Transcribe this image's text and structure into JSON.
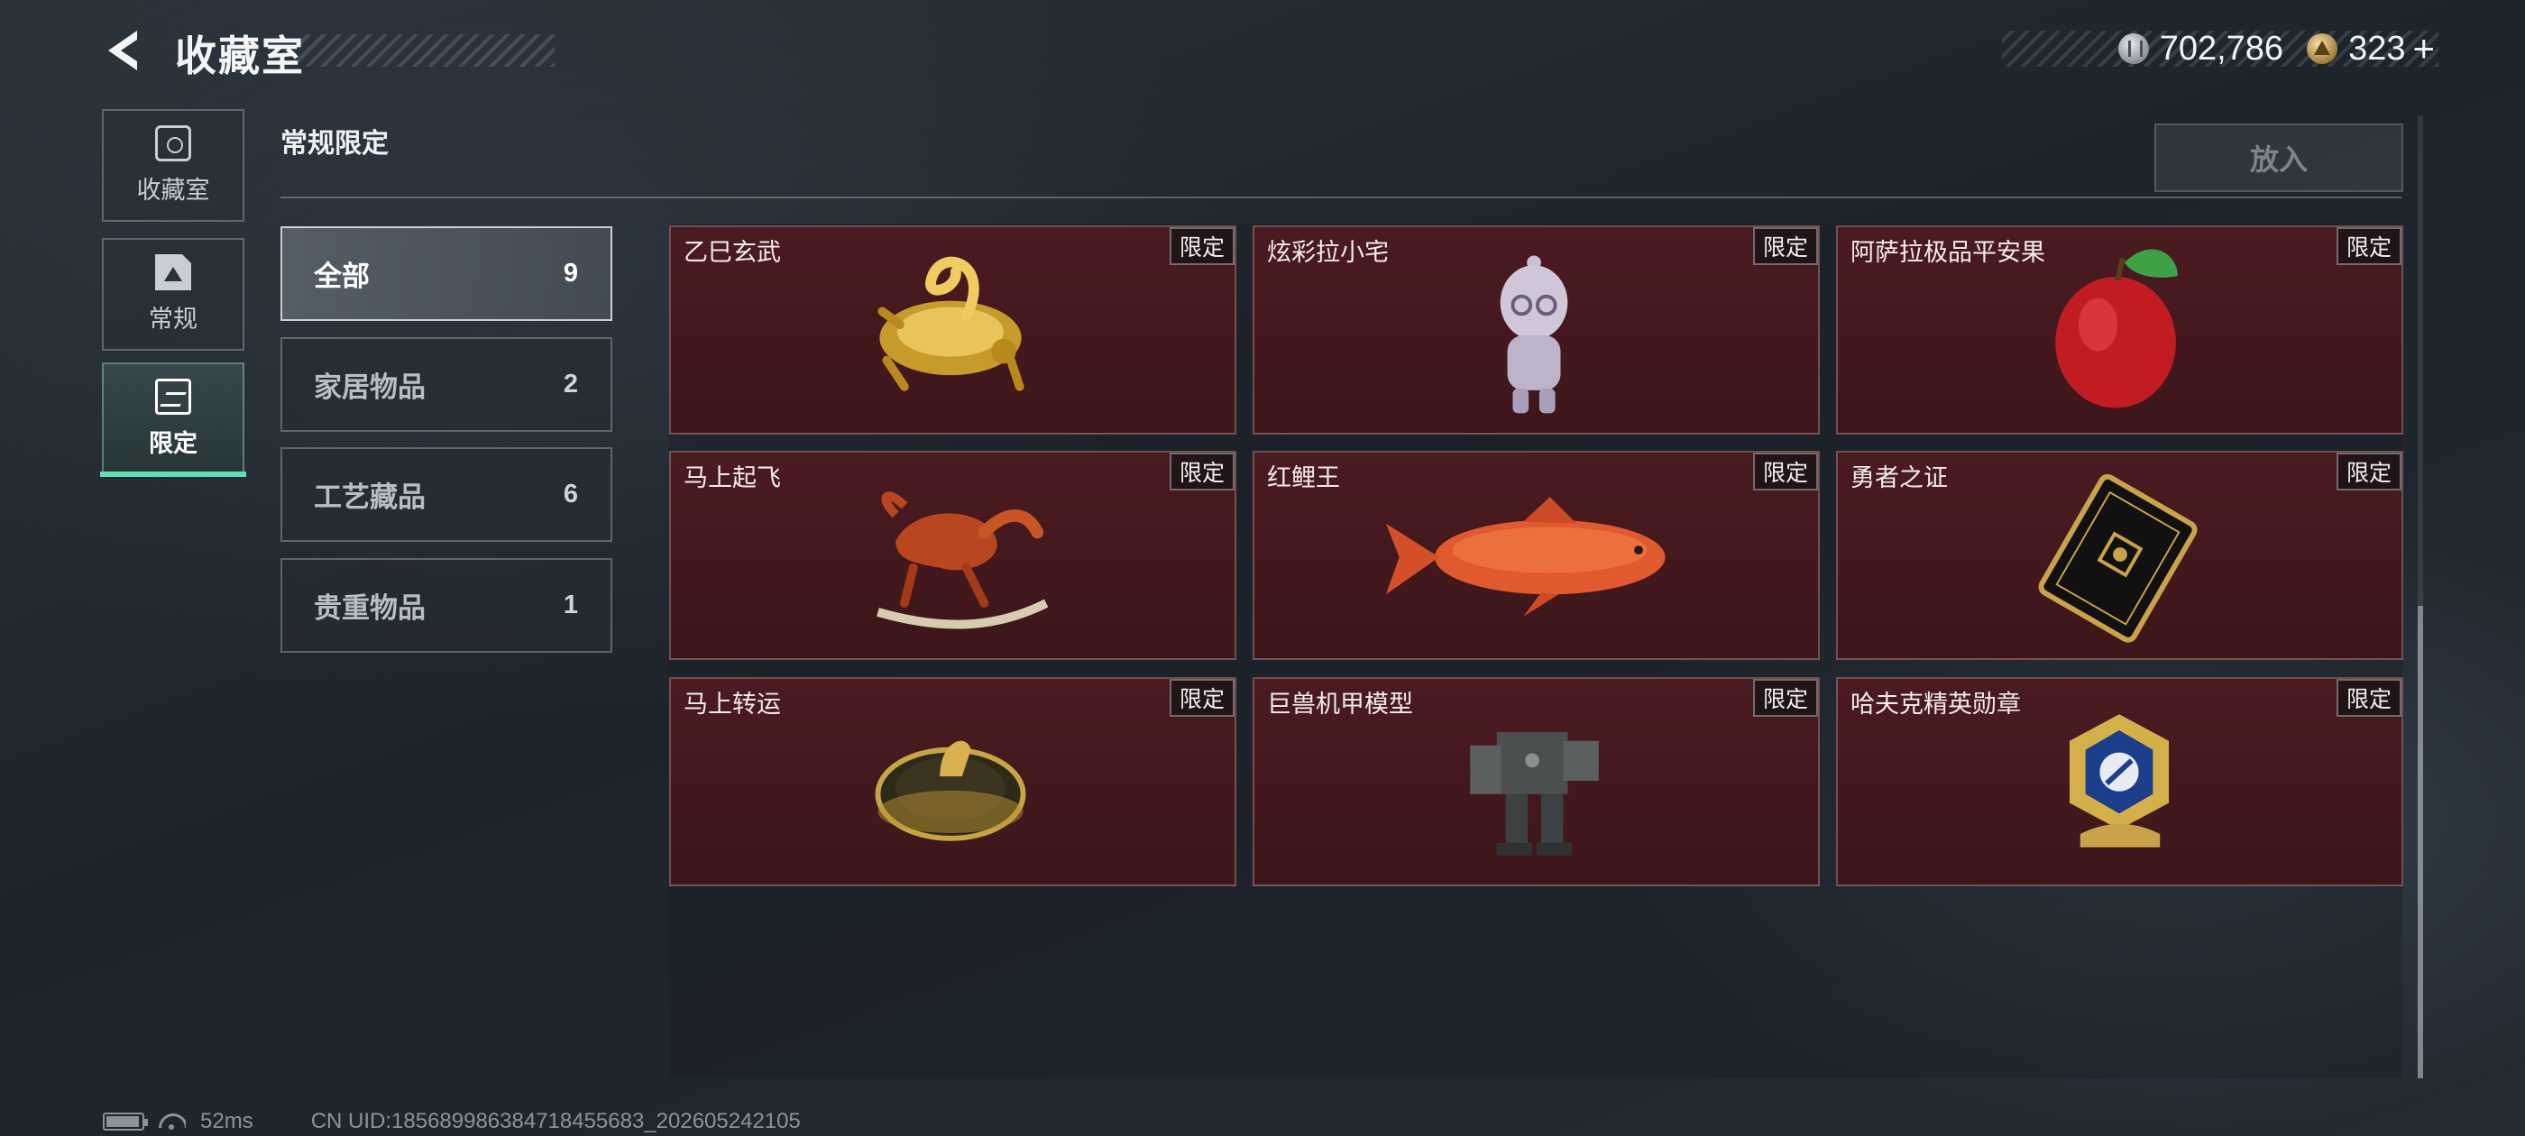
{
  "header": {
    "title": "收藏室",
    "currency": [
      {
        "icon": "silver-coin-icon",
        "value": "702,786"
      },
      {
        "icon": "gold-triangle-coin-icon",
        "value": "323",
        "plus": "+"
      }
    ]
  },
  "rail": [
    {
      "label": "收藏室",
      "icon": "collection-room-icon"
    },
    {
      "label": "常规",
      "icon": "regular-doc-icon"
    },
    {
      "label": "限定",
      "icon": "limited-icon",
      "active": true
    }
  ],
  "section": {
    "title": "常规限定",
    "place_button": "放入"
  },
  "categories": [
    {
      "name": "全部",
      "count": "9",
      "active": true
    },
    {
      "name": "家居物品",
      "count": "2"
    },
    {
      "name": "工艺藏品",
      "count": "6"
    },
    {
      "name": "贵重物品",
      "count": "1"
    }
  ],
  "items": [
    {
      "name": "乙巳玄武",
      "tag": "限定",
      "icon": "golden-snake-tortoise-icon"
    },
    {
      "name": "炫彩拉小宅",
      "tag": "限定",
      "icon": "silver-figurine-icon"
    },
    {
      "name": "阿萨拉极品平安果",
      "tag": "限定",
      "icon": "red-apple-icon"
    },
    {
      "name": "马上起飞",
      "tag": "限定",
      "icon": "red-horse-statue-icon"
    },
    {
      "name": "红鲤王",
      "tag": "限定",
      "icon": "red-carp-icon"
    },
    {
      "name": "勇者之证",
      "tag": "限定",
      "icon": "black-gold-card-icon"
    },
    {
      "name": "马上转运",
      "tag": "限定",
      "icon": "horse-disc-icon"
    },
    {
      "name": "巨兽机甲模型",
      "tag": "限定",
      "icon": "mech-model-icon"
    },
    {
      "name": "哈夫克精英勋章",
      "tag": "限定",
      "icon": "elite-medal-icon"
    }
  ],
  "footer": {
    "ping": "52ms",
    "uid": "CN UID:185689986384718455683_202605242105"
  },
  "colors": {
    "accent": "#5fe0b0",
    "card_bg": "#4a1b20"
  }
}
